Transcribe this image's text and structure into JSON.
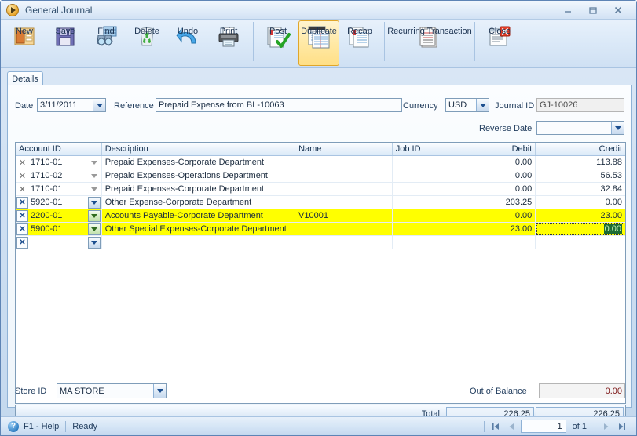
{
  "window": {
    "title": "General Journal",
    "app_icon": "play-circle-icon",
    "minimize": "minimize-icon",
    "maximize": "maximize-icon",
    "close": "close-icon"
  },
  "toolbar": {
    "buttons": [
      {
        "label": "New",
        "icon": "new-document-icon"
      },
      {
        "label": "Save",
        "icon": "floppy-disk-icon"
      },
      {
        "label": "Find",
        "icon": "binoculars-icon"
      },
      {
        "label": "Delete",
        "icon": "recycle-bin-icon"
      },
      {
        "label": "Undo",
        "icon": "undo-arrow-icon"
      },
      {
        "label": "Print",
        "icon": "printer-icon"
      },
      {
        "label": "Post",
        "icon": "post-checkmark-icon"
      },
      {
        "label": "Duplicate",
        "icon": "duplicate-pages-icon",
        "state": "hover"
      },
      {
        "label": "Recap",
        "icon": "recap-pages-icon"
      },
      {
        "label": "Recurring Transaction",
        "icon": "notepad-icon"
      },
      {
        "label": "Close",
        "icon": "close-window-icon"
      }
    ]
  },
  "tabs": [
    {
      "label": "Details",
      "active": true
    }
  ],
  "form": {
    "date_label": "Date",
    "date_value": "3/11/2011",
    "reference_label": "Reference",
    "reference_value": "Prepaid Expense from BL-10063",
    "currency_label": "Currency",
    "currency_value": "USD",
    "journal_id_label": "Journal ID",
    "journal_id_value": "GJ-10026",
    "reverse_date_label": "Reverse Date",
    "reverse_date_value": "",
    "store_id_label": "Store ID",
    "store_id_value": "MA STORE",
    "out_of_balance_label": "Out of Balance",
    "out_of_balance_value": "0.00"
  },
  "grid": {
    "columns": [
      "Account ID",
      "Description",
      "Name",
      "Job ID",
      "Debit",
      "Credit"
    ],
    "rows": [
      {
        "account_id": "1710-01",
        "description": "Prepaid Expenses-Corporate Department",
        "name": "",
        "job_id": "",
        "debit": "0.00",
        "credit": "113.88",
        "highlight": false,
        "editable": false
      },
      {
        "account_id": "1710-02",
        "description": "Prepaid Expenses-Operations Department",
        "name": "",
        "job_id": "",
        "debit": "0.00",
        "credit": "56.53",
        "highlight": false,
        "editable": false
      },
      {
        "account_id": "1710-01",
        "description": "Prepaid Expenses-Corporate Department",
        "name": "",
        "job_id": "",
        "debit": "0.00",
        "credit": "32.84",
        "highlight": false,
        "editable": false
      },
      {
        "account_id": "5920-01",
        "description": "Other Expense-Corporate Department",
        "name": "",
        "job_id": "",
        "debit": "203.25",
        "credit": "0.00",
        "highlight": false,
        "editable": true
      },
      {
        "account_id": "2200-01",
        "description": "Accounts Payable-Corporate Department",
        "name": "V10001",
        "job_id": "",
        "debit": "0.00",
        "credit": "23.00",
        "highlight": true,
        "editable": true
      },
      {
        "account_id": "5900-01",
        "description": "Other Special Expenses-Corporate Department",
        "name": "",
        "job_id": "",
        "debit": "23.00",
        "credit": "0.00",
        "highlight": true,
        "editable": true,
        "credit_focused": true
      },
      {
        "account_id": "",
        "description": "",
        "name": "",
        "job_id": "",
        "debit": "",
        "credit": "",
        "highlight": false,
        "editable": true,
        "blank": true
      }
    ]
  },
  "totals": {
    "label": "Total",
    "debit": "226.25",
    "credit": "226.25"
  },
  "statusbar": {
    "help_icon": "question-mark-icon",
    "help_text": "F1 - Help",
    "status_text": "Ready",
    "first_icon": "first-page-icon",
    "prev_icon": "previous-page-icon",
    "page_value": "1",
    "of_text": "of  1",
    "next_icon": "next-page-icon",
    "last_icon": "last-page-icon"
  },
  "colors": {
    "highlight_row": "#ffff00",
    "selection_bg": "#1d6b33",
    "out_of_balance_text": "#7a1212",
    "accent": "#5e84b5"
  }
}
